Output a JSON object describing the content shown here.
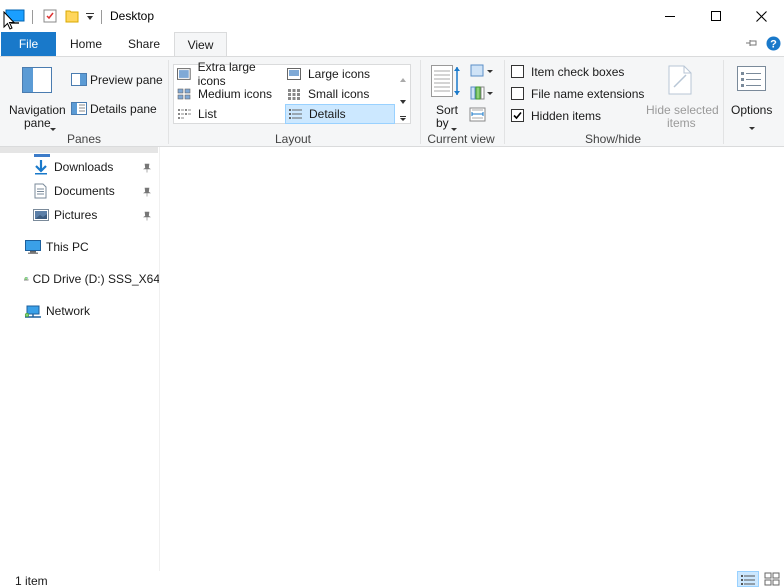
{
  "window": {
    "title": "Desktop"
  },
  "tabs": {
    "file": "File",
    "home": "Home",
    "share": "Share",
    "view": "View"
  },
  "ribbon": {
    "panes": {
      "group_label": "Panes",
      "navigation_line1": "Navigation",
      "navigation_line2": "pane",
      "preview": "Preview pane",
      "details": "Details pane"
    },
    "layout": {
      "group_label": "Layout",
      "items": [
        "Extra large icons",
        "Large icons",
        "Medium icons",
        "Small icons",
        "List",
        "Details"
      ],
      "selected": "Details"
    },
    "current_view": {
      "group_label": "Current view",
      "sort_line1": "Sort",
      "sort_line2": "by"
    },
    "show_hide": {
      "group_label": "Show/hide",
      "item_check_boxes": "Item check boxes",
      "file_name_extensions": "File name extensions",
      "hidden_items": "Hidden items",
      "hide_selected_line1": "Hide selected",
      "hide_selected_line2": "items",
      "checked": {
        "item_check_boxes": false,
        "file_name_extensions": false,
        "hidden_items": true
      }
    },
    "options": {
      "label": "Options"
    }
  },
  "nav": {
    "downloads": "Downloads",
    "documents": "Documents",
    "pictures": "Pictures",
    "this_pc": "This PC",
    "cd_drive": "CD Drive (D:) SSS_X64",
    "network": "Network"
  },
  "status": {
    "item_count": "1 item"
  },
  "colors": {
    "accent": "#1979ca",
    "selected_bg": "#cce8ff",
    "selected_border": "#99d1ff"
  }
}
